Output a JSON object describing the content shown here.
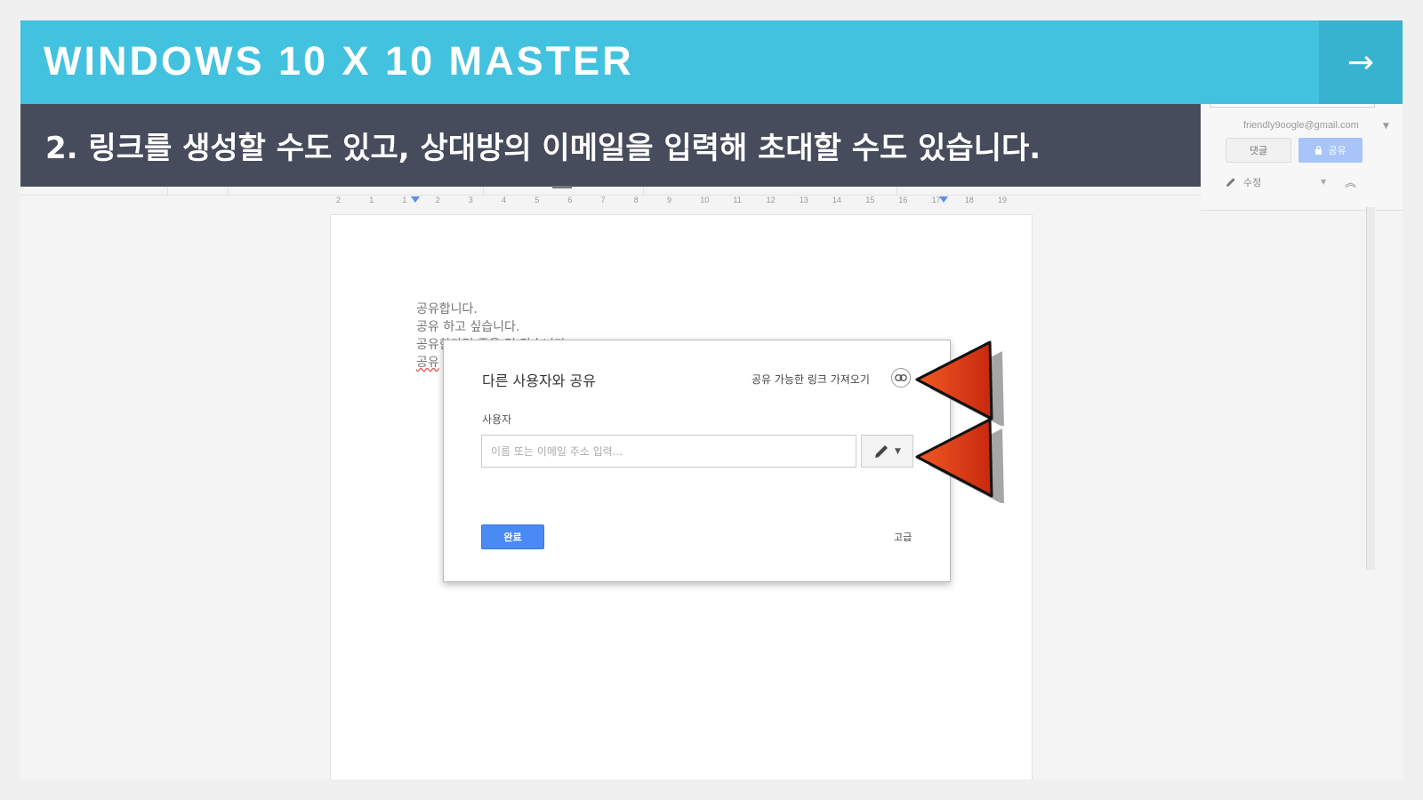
{
  "banner": {
    "title": "WINDOWS 10 X 10 MASTER",
    "next_glyph": "→"
  },
  "caption": "2. 링크를 생성할 수도 있고, 상대방의 이메일을 입력해 초대할 수도 있습니다.",
  "account": {
    "email": "friendly9oogle@gmail.com",
    "comment_label": "댓글",
    "share_label": "공유",
    "edit_label": "수정"
  },
  "ruler": {
    "numbers": [
      "2",
      "1",
      "1",
      "2",
      "3",
      "4",
      "5",
      "6",
      "7",
      "8",
      "9",
      "10",
      "11",
      "12",
      "13",
      "14",
      "15",
      "16",
      "17",
      "18",
      "19"
    ]
  },
  "document": {
    "lines": [
      "공유합니다.",
      "공유 하고 싶습니다.",
      "공유한다면 좋을 것 같습니다.",
      "공유"
    ]
  },
  "dialog": {
    "title": "다른 사용자와 공유",
    "link_text": "공유 가능한 링크 가져오기",
    "users_label": "사용자",
    "input_placeholder": "이름 또는 이메일 주소 입력...",
    "done_label": "완료",
    "advanced_label": "고급"
  },
  "colors": {
    "banner": "#42c2de",
    "caption_bar": "#464c5c",
    "arrow": "#e2401c",
    "done_button": "#4a8af4"
  }
}
